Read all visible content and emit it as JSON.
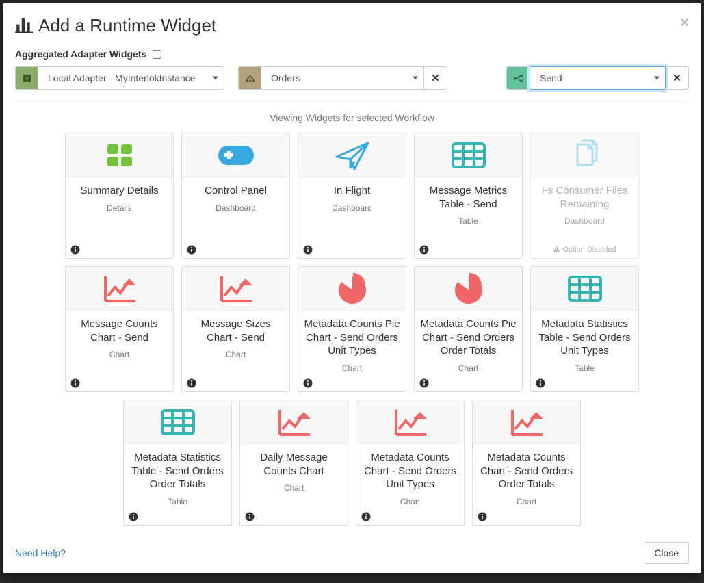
{
  "modal": {
    "title": "Add a Runtime Widget",
    "aggregated_label": "Aggregated Adapter Widgets",
    "aggregated_checked": false,
    "adapter_select": "Local Adapter - MyInterlokInstance",
    "channel_select": "Orders",
    "workflow_select": "Send",
    "viewing_text": "Viewing Widgets for selected Workflow",
    "help_link": "Need Help?",
    "close_label": "Close"
  },
  "cards": [
    {
      "title": "Summary Details",
      "sub": "Details",
      "icon": "grid-green",
      "disabled": false,
      "note": null
    },
    {
      "title": "Control Panel",
      "sub": "Dashboard",
      "icon": "controller",
      "disabled": false,
      "note": null
    },
    {
      "title": "In Flight",
      "sub": "Dashboard",
      "icon": "plane",
      "disabled": false,
      "note": null
    },
    {
      "title": "Message Metrics Table - Send",
      "sub": "Table",
      "icon": "table-teal",
      "disabled": false,
      "note": null
    },
    {
      "title": "Fs Consumer Files Remaining",
      "sub": "Dashboard",
      "icon": "copy-doc",
      "disabled": true,
      "note": "Option Disabled"
    },
    {
      "title": "Message Counts Chart - Send",
      "sub": "Chart",
      "icon": "line-chart",
      "disabled": false,
      "note": null
    },
    {
      "title": "Message Sizes Chart - Send",
      "sub": "Chart",
      "icon": "line-chart",
      "disabled": false,
      "note": null
    },
    {
      "title": "Metadata Counts Pie Chart - Send Orders Unit Types",
      "sub": "Chart",
      "icon": "pie",
      "disabled": false,
      "note": null
    },
    {
      "title": "Metadata Counts Pie Chart - Send Orders Order Totals",
      "sub": "Chart",
      "icon": "pie",
      "disabled": false,
      "note": null
    },
    {
      "title": "Metadata Statistics Table - Send Orders Unit Types",
      "sub": "Table",
      "icon": "table-teal",
      "disabled": false,
      "note": null
    },
    {
      "title": "Metadata Statistics Table - Send Orders Order Totals",
      "sub": "Table",
      "icon": "table-teal",
      "disabled": false,
      "note": null
    },
    {
      "title": "Daily Message Counts Chart",
      "sub": "Chart",
      "icon": "line-chart",
      "disabled": false,
      "note": null
    },
    {
      "title": "Metadata Counts Chart - Send Orders Unit Types",
      "sub": "Chart",
      "icon": "line-chart",
      "disabled": false,
      "note": null
    },
    {
      "title": "Metadata Counts Chart - Send Orders Order Totals",
      "sub": "Chart",
      "icon": "line-chart",
      "disabled": false,
      "note": null
    }
  ]
}
